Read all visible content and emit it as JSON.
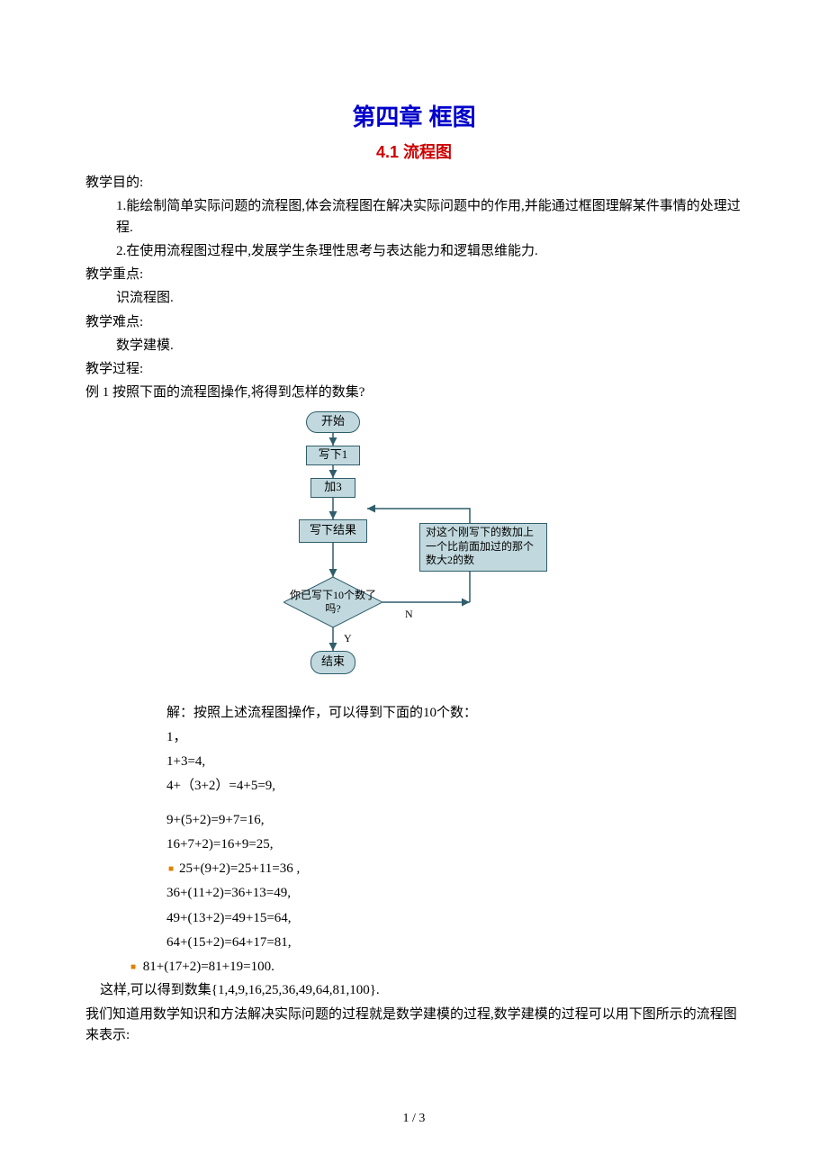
{
  "title_main": "第四章 框图",
  "title_sub": "4.1 流程图",
  "sec": {
    "goal_h": "教学目的:",
    "goal_1": "1.能绘制简单实际问题的流程图,体会流程图在解决实际问题中的作用,并能通过框图理解某件事情的处理过程.",
    "goal_2": "2.在使用流程图过程中,发展学生条理性思考与表达能力和逻辑思维能力.",
    "focus_h": "教学重点:",
    "focus_1": "识流程图.",
    "hard_h": "教学难点:",
    "hard_1": "数学建模.",
    "proc_h": "教学过程:",
    "ex1": "例 1   按照下面的流程图操作,将得到怎样的数集?"
  },
  "flow": {
    "start": "开始",
    "write1": "写下1",
    "add3": "加3",
    "writeResult": "写下结果",
    "sideBox": "对这个刚写下的数加上一个比前面加过的那个数大2的数",
    "decision": "你已写下10个数了吗?",
    "no": "N",
    "yes": "Y",
    "end": "结束"
  },
  "ans": {
    "intro": "解：按照上述流程图操作，可以得到下面的10个数：",
    "l1": "1，",
    "l2": "1+3=4,",
    "l3": "4+（3+2）=4+5=9,",
    "l4": "9+(5+2)=9+7=16,",
    "l5": "16+7+2)=16+9=25,",
    "l6": "25+(9+2)=25+11=36 ,",
    "l7": "36+(11+2)=36+13=49,",
    "l8": "49+(13+2)=49+15=64,",
    "l9": "64+(15+2)=64+17=81,",
    "l10": "81+(17+2)=81+19=100.",
    "set": "这样,可以得到数集{1,4,9,16,25,36,49,64,81,100}."
  },
  "closing1": "我们知道用数学知识和方法解决实际问题的过程就是数学建模的过程,数学建模的过程可以用下图所示的流程图来表示:",
  "page_number": "1 / 3"
}
